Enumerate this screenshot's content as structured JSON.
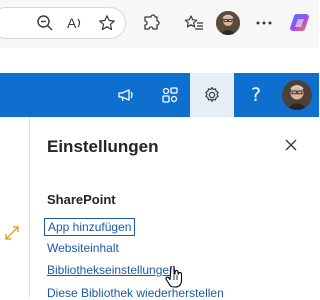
{
  "browser": {
    "icons": [
      "zoom-out-icon",
      "read-aloud-icon",
      "favorite-star-icon",
      "extensions-icon",
      "favorites-icon",
      "profile-avatar",
      "more-icon",
      "copilot-icon"
    ]
  },
  "suite_bar": {
    "color": "#0f6fce",
    "help_label": "?"
  },
  "panel": {
    "title": "Einstellungen",
    "section": "SharePoint",
    "links": [
      "App hinzufügen",
      "Websiteinhalt",
      "Bibliothekseinstellungen",
      "Diese Bibliothek wiederherstellen"
    ]
  }
}
